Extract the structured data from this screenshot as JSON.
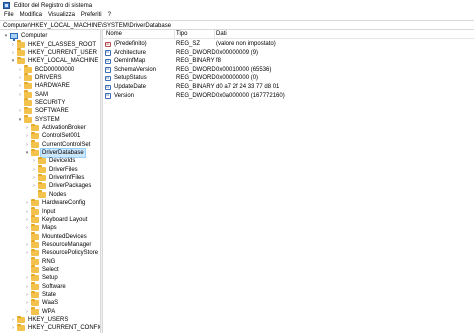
{
  "window": {
    "title": "Editor del Registro di sistema"
  },
  "menu": [
    "File",
    "Modifica",
    "Visualizza",
    "Preferiti",
    "?"
  ],
  "address": "Computer\\HKEY_LOCAL_MACHINE\\SYSTEM\\DriverDatabase",
  "tree": [
    {
      "label": "Computer",
      "icon": "computer-icon",
      "twisty": "▾"
    },
    {
      "label": "HKEY_CLASSES_ROOT",
      "icon": "folder-icon",
      "twisty": "›"
    },
    {
      "label": "HKEY_CURRENT_USER",
      "icon": "folder-icon",
      "twisty": "›"
    },
    {
      "label": "HKEY_LOCAL_MACHINE",
      "icon": "folder-icon",
      "twisty": "▾"
    },
    {
      "label": "BCD00000000",
      "icon": "folder-icon",
      "twisty": "›"
    },
    {
      "label": "DRIVERS",
      "icon": "folder-icon",
      "twisty": "›"
    },
    {
      "label": "HARDWARE",
      "icon": "folder-icon",
      "twisty": "›"
    },
    {
      "label": "SAM",
      "icon": "folder-icon",
      "twisty": "›"
    },
    {
      "label": "SECURITY",
      "icon": "folder-icon",
      "twisty": ""
    },
    {
      "label": "SOFTWARE",
      "icon": "folder-icon",
      "twisty": "›"
    },
    {
      "label": "SYSTEM",
      "icon": "folder-icon",
      "twisty": "▾"
    },
    {
      "label": "ActivationBroker",
      "icon": "folder-icon",
      "twisty": "›"
    },
    {
      "label": "ControlSet001",
      "icon": "folder-icon",
      "twisty": "›"
    },
    {
      "label": "CurrentControlSet",
      "icon": "folder-icon",
      "twisty": "›"
    },
    {
      "label": "DriverDatabase",
      "icon": "folder-icon",
      "twisty": "▾",
      "selected": true
    },
    {
      "label": "DeviceIds",
      "icon": "folder-icon",
      "twisty": "›"
    },
    {
      "label": "DriverFiles",
      "icon": "folder-icon",
      "twisty": "›"
    },
    {
      "label": "DriverInfFiles",
      "icon": "folder-icon",
      "twisty": "›"
    },
    {
      "label": "DriverPackages",
      "icon": "folder-icon",
      "twisty": "›"
    },
    {
      "label": "Nodes",
      "icon": "folder-icon",
      "twisty": ""
    },
    {
      "label": "HardwareConfig",
      "icon": "folder-icon",
      "twisty": "›"
    },
    {
      "label": "Input",
      "icon": "folder-icon",
      "twisty": "›"
    },
    {
      "label": "Keyboard Layout",
      "icon": "folder-icon",
      "twisty": "›"
    },
    {
      "label": "Maps",
      "icon": "folder-icon",
      "twisty": "›"
    },
    {
      "label": "MountedDevices",
      "icon": "folder-icon",
      "twisty": ""
    },
    {
      "label": "ResourceManager",
      "icon": "folder-icon",
      "twisty": "›"
    },
    {
      "label": "ResourcePolicyStore",
      "icon": "folder-icon",
      "twisty": "›"
    },
    {
      "label": "RNG",
      "icon": "folder-icon",
      "twisty": ""
    },
    {
      "label": "Select",
      "icon": "folder-icon",
      "twisty": ""
    },
    {
      "label": "Setup",
      "icon": "folder-icon",
      "twisty": "›"
    },
    {
      "label": "Software",
      "icon": "folder-icon",
      "twisty": "›"
    },
    {
      "label": "State",
      "icon": "folder-icon",
      "twisty": "›"
    },
    {
      "label": "WaaS",
      "icon": "folder-icon",
      "twisty": "›"
    },
    {
      "label": "WPA",
      "icon": "folder-icon",
      "twisty": "›"
    },
    {
      "label": "HKEY_USERS",
      "icon": "folder-icon",
      "twisty": "›"
    },
    {
      "label": "HKEY_CURRENT_CONFIG",
      "icon": "folder-icon",
      "twisty": "›"
    }
  ],
  "columns": {
    "name": "Nome",
    "type": "Tipo",
    "data": "Dati"
  },
  "values": [
    {
      "name": "(Predefinito)",
      "type": "REG_SZ",
      "data": "(valore non impostato)",
      "icon": "sz"
    },
    {
      "name": "Architecture",
      "type": "REG_DWORD",
      "data": "0x00000009 (9)",
      "icon": "bin"
    },
    {
      "name": "OemInfMap",
      "type": "REG_BINARY",
      "data": "f8",
      "icon": "bin"
    },
    {
      "name": "SchemaVersion",
      "type": "REG_DWORD",
      "data": "0x00010000 (65536)",
      "icon": "bin"
    },
    {
      "name": "SetupStatus",
      "type": "REG_DWORD",
      "data": "0x00000000 (0)",
      "icon": "bin"
    },
    {
      "name": "UpdateDate",
      "type": "REG_BINARY",
      "data": "d0 a7 2f 24 33 77 d8 01",
      "icon": "bin"
    },
    {
      "name": "Version",
      "type": "REG_DWORD",
      "data": "0x0a000000 (167772160)",
      "icon": "bin"
    }
  ],
  "colors": {
    "selection": "#cce8ff",
    "folder": "#f3c24c"
  }
}
